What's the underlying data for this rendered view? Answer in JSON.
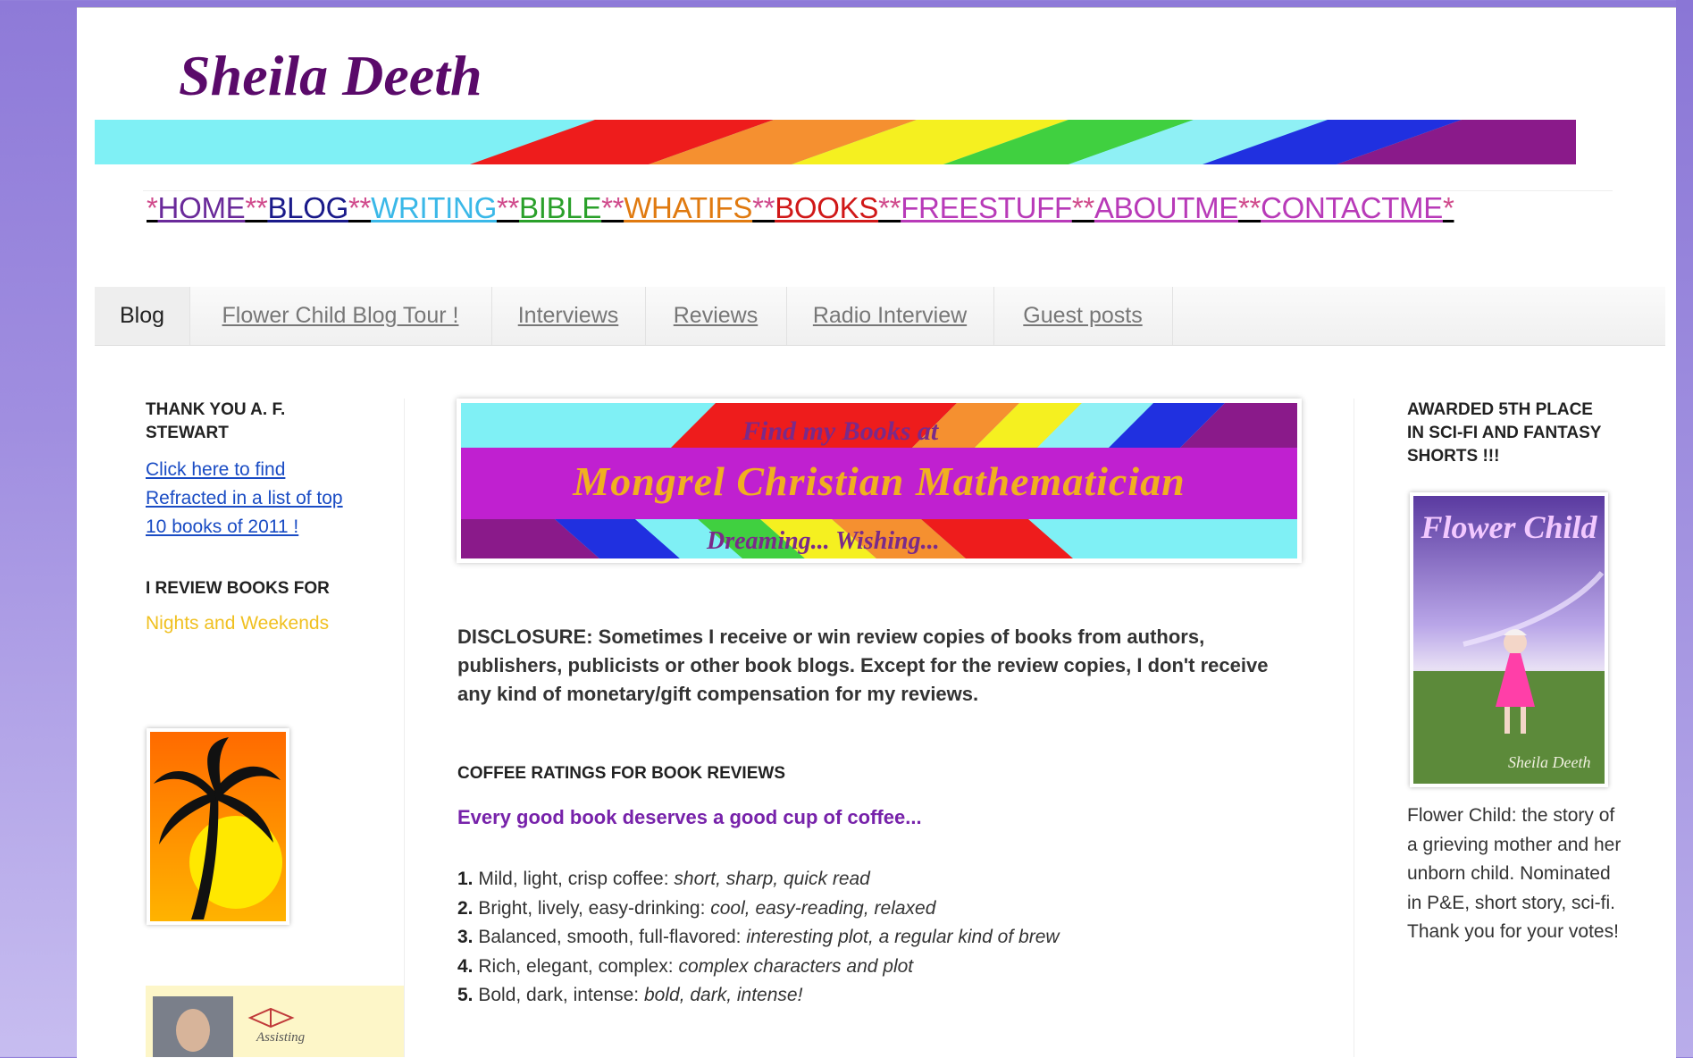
{
  "site": {
    "title": "Sheila Deeth"
  },
  "nav": {
    "items": [
      {
        "label": "HOME",
        "color": "#6a2a9a"
      },
      {
        "label": "BLOG",
        "color": "#1a1a8a"
      },
      {
        "label": "WRITING",
        "color": "#3ab8e8"
      },
      {
        "label": "BIBLE",
        "color": "#2aa02a"
      },
      {
        "label": "WHATIFS",
        "color": "#e07a10"
      },
      {
        "label": "BOOKS",
        "color": "#d01818"
      },
      {
        "label": "FREESTUFF",
        "color": "#b83ab8"
      },
      {
        "label": "ABOUTME",
        "color": "#b83ab8"
      },
      {
        "label": "CONTACTME",
        "color": "#b83ab8"
      }
    ],
    "sep": "**",
    "edge": "*"
  },
  "tabs": [
    "Blog",
    "Flower Child Blog Tour !",
    "Interviews",
    "Reviews",
    "Radio Interview",
    "Guest posts"
  ],
  "left": {
    "thanks_title": "THANK YOU A. F. STEWART",
    "thanks_link": "Click here to find Refracted in a list of top 10 books of 2011 !",
    "review_title": "I REVIEW BOOKS FOR",
    "review_site": "Nights and Weekends",
    "author_badge_text": "Assisting"
  },
  "banner": {
    "line1": "Find my Books at",
    "line2": "Mongrel Christian Mathematician",
    "line3": "Dreaming... Wishing..."
  },
  "main": {
    "disclosure": "DISCLOSURE: Sometimes I receive or win review copies of books from authors, publishers, publicists or other book blogs. Except for the review copies, I don't receive any kind of monetary/gift compensation for my reviews.",
    "coffee_title": "COFFEE RATINGS FOR BOOK REVIEWS",
    "tagline": "Every good book deserves a good cup of coffee...",
    "ratings": [
      {
        "num": "1.",
        "label": "Mild, light, crisp coffee:",
        "desc": "short, sharp, quick read"
      },
      {
        "num": "2.",
        "label": "Bright, lively, easy-drinking:",
        "desc": "cool, easy-reading, relaxed"
      },
      {
        "num": "3.",
        "label": "Balanced, smooth, full-flavored:",
        "desc": "interesting plot, a regular kind of brew"
      },
      {
        "num": "4.",
        "label": "Rich, elegant, complex:",
        "desc": "complex characters and plot"
      },
      {
        "num": "5.",
        "label": "Bold, dark, intense:",
        "desc": "bold, dark, intense!"
      }
    ]
  },
  "right": {
    "award_title": "AWARDED 5TH PLACE IN SCI-FI AND FANTASY SHORTS !!!",
    "cover_title": "Flower Child",
    "cover_author": "Sheila Deeth",
    "description": "Flower Child: the story of a grieving mother and her unborn child. Nominated in P&E, short story, sci-fi. Thank you for your votes!"
  }
}
